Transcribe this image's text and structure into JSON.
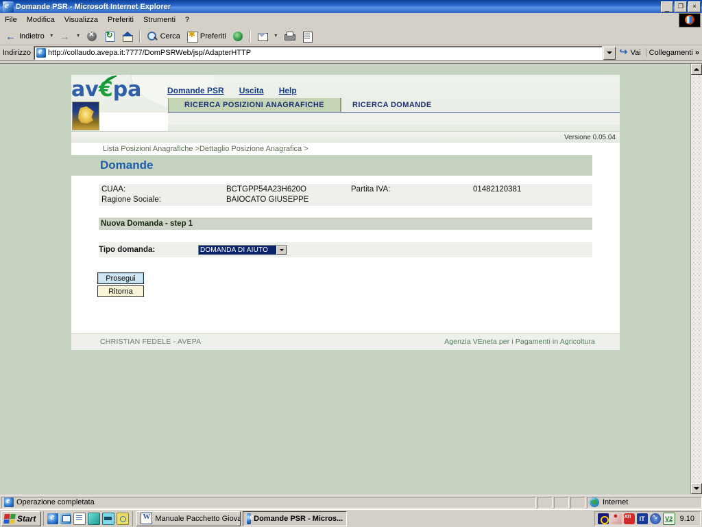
{
  "window": {
    "title": "Domande PSR - Microsoft Internet Explorer",
    "minimize": "_",
    "maximize": "❐",
    "close": "×"
  },
  "menubar": {
    "items": [
      {
        "label": "File"
      },
      {
        "label": "Modifica"
      },
      {
        "label": "Visualizza"
      },
      {
        "label": "Preferiti"
      },
      {
        "label": "Strumenti"
      },
      {
        "label": "?"
      }
    ]
  },
  "toolbar": {
    "back_label": "Indietro",
    "forward_label": "",
    "search_label": "Cerca",
    "favorites_label": "Preferiti"
  },
  "address": {
    "label": "Indirizzo",
    "url": "http://collaudo.avepa.it:7777/DomPSRWeb/jsp/AdapterHTTP",
    "go_label": "Vai",
    "links_label": "Collegamenti",
    "links_chevron": "»"
  },
  "page": {
    "logo": {
      "text_a": "av",
      "text_e": "€",
      "text_pa": "pa",
      "alt": "avepa"
    },
    "nav": [
      {
        "label": "Domande PSR"
      },
      {
        "label": "Uscita"
      },
      {
        "label": "Help"
      }
    ],
    "tabs": [
      {
        "label": "RICERCA POSIZIONI ANAGRAFICHE",
        "active": true
      },
      {
        "label": "RICERCA DOMANDE",
        "active": false
      }
    ],
    "version": "Versione 0.05.04",
    "breadcrumb": "Lista Posizioni Anagrafiche >Dettaglio Posizione Anagrafica >",
    "title": "Domande",
    "details": {
      "cuaa_label": "CUAA:",
      "cuaa_value": "BCTGPP54A23H620O",
      "ragione_label": "Ragione Sociale:",
      "ragione_value": "BAIOCATO GIUSEPPE",
      "piva_label": "Partita IVA:",
      "piva_value": "01482120381"
    },
    "step_band": "Nuova Domanda - step 1",
    "form": {
      "tipo_label": "Tipo domanda:",
      "tipo_value": "DOMANDA DI AIUTO"
    },
    "buttons": {
      "prosegui": "Prosegui",
      "ritorna": "Ritorna"
    },
    "footer": {
      "user": "CHRISTIAN FEDELE - AVEPA",
      "agency": "Agenzia VEneta per i Pagamenti in Agricoltura"
    }
  },
  "statusbar": {
    "message": "Operazione completata",
    "zone": "Internet"
  },
  "taskbar": {
    "start": "Start",
    "buttons": [
      {
        "label": "Manuale Pacchetto Giova...",
        "active": false
      },
      {
        "label": "Domande PSR - Micros...",
        "active": true
      }
    ],
    "tray": {
      "language": "IT",
      "antivirus": "V2",
      "clock": "9.10"
    }
  },
  "colors": {
    "titlebar_blue": "#0c3f9c",
    "chrome_gray": "#d4d0c8",
    "page_sage": "#c6d2c0",
    "tab_green": "#c4d4b5",
    "nav_navy": "#123a8a",
    "title_blue": "#1b5fa8",
    "select_highlight": "#0a246a",
    "button_focus": "#cfe6f5",
    "button_plain": "#f7f4d8"
  }
}
